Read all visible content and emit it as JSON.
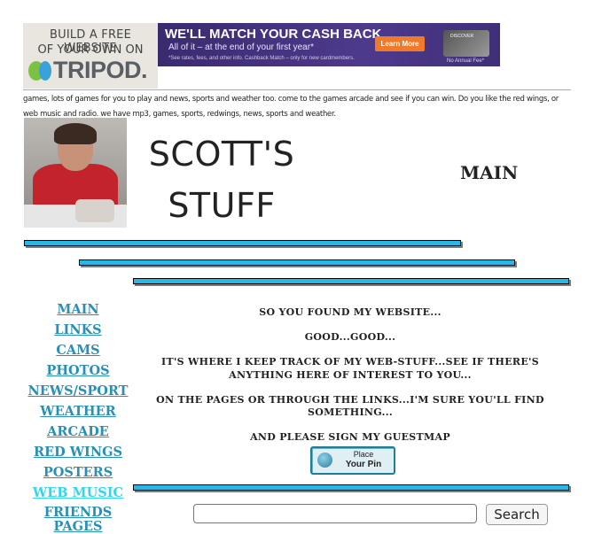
{
  "ads": {
    "tripod": {
      "line1": "BUILD A FREE WEBSITE",
      "line2": "OF YOUR OWN ON",
      "logo_text": "TRIPOD."
    },
    "discover": {
      "headline": "WE'LL MATCH YOUR CASH BACK",
      "subline": "All of it – at the end of your first year*",
      "fine_print": "*See rates, fees, and other info. Cashback Match – only for new cardmembers.",
      "cta": "Learn More",
      "card_label": "DISCOVER",
      "no_annual_fee": "No Annual Fee*"
    }
  },
  "keywords": "games, lots of games for you to play and news, sports and weather too.  come to the games arcade and see if you can win.  Do you like the red wings, or web music and radio.  we have mp3, games, sports, redwings, news, sports and weather.",
  "header": {
    "title_line1": "SCOTT'S",
    "title_line2": "STUFF",
    "page_label": "MAIN"
  },
  "nav": [
    {
      "label": "MAIN"
    },
    {
      "label": "LINKS"
    },
    {
      "label": "CAMS"
    },
    {
      "label": "PHOTOS"
    },
    {
      "label": "NEWS/SPORT"
    },
    {
      "label": "WEATHER"
    },
    {
      "label": "ARCADE"
    },
    {
      "label": "RED WINGS"
    },
    {
      "label": "POSTERS"
    },
    {
      "label": "WEB MUSIC"
    },
    {
      "label": "FRIENDS"
    },
    {
      "label": "PAGES"
    }
  ],
  "content": {
    "p1": "SO YOU FOUND MY WEBSITE...",
    "p2": "GOOD...GOOD...",
    "p3": "IT'S WHERE I KEEP TRACK OF MY WEB-STUFF...SEE IF THERE'S ANYTHING HERE OF INTEREST TO YOU...",
    "p4": "ON THE PAGES OR THROUGH THE LINKS...I'M SURE YOU'LL FIND SOMETHING...",
    "p5": "AND PLEASE SIGN MY GUESTMAP"
  },
  "guestmap_button": {
    "line1": "Place",
    "line2": "Your Pin"
  },
  "search": {
    "value": "",
    "button_label": "Search"
  },
  "colors": {
    "bar": "#29b7e6",
    "link": "#2a8fb5",
    "link_active": "#33d6ea"
  },
  "icons": [
    "globe-icon"
  ]
}
